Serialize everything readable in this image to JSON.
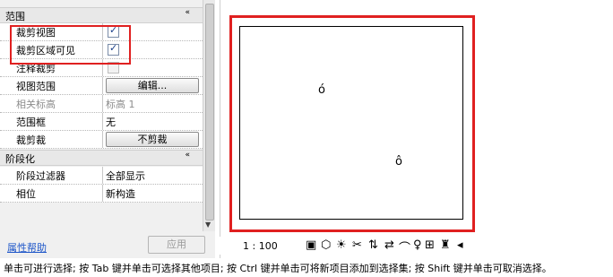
{
  "properties": {
    "section_range": {
      "title": "范围",
      "collapse": "«"
    },
    "rows": [
      {
        "label": "裁剪视图",
        "checked": true,
        "mark": "✓"
      },
      {
        "label": "裁剪区域可见",
        "checked": true,
        "mark": "✓"
      },
      {
        "label": "注释裁剪",
        "checked": false,
        "mark": ""
      },
      {
        "label": "视图范围",
        "button": "编辑..."
      },
      {
        "label": "相关标高",
        "value": "标高 1"
      },
      {
        "label": "范围框",
        "value": "无"
      },
      {
        "label": "裁剪裁",
        "button": "不剪裁"
      }
    ],
    "section_phase": {
      "title": "阶段化",
      "collapse": "«"
    },
    "phase_rows": [
      {
        "label": "阶段过滤器",
        "value": "全部显示"
      },
      {
        "label": "相位",
        "value": "新构造"
      }
    ],
    "help_link": "属性帮助",
    "apply_button": "应用",
    "scroll_arrow": "▼"
  },
  "view": {
    "scale": "1 : 100",
    "marker_1": "ό",
    "marker_2": "ô"
  },
  "status_icons": [
    "▣",
    "⬡",
    "☀",
    "✂",
    "⇅",
    "⇄",
    "⌒",
    "♀",
    "⊞",
    "♜",
    "◂"
  ],
  "hint": "单击可进行选择; 按 Tab 键并单击可选择其他项目; 按 Ctrl 键并单击可将新项目添加到选择集; 按 Shift 键并单击可取消选择。",
  "colors": {
    "highlight": "#e02020",
    "link": "#1f57c9"
  }
}
